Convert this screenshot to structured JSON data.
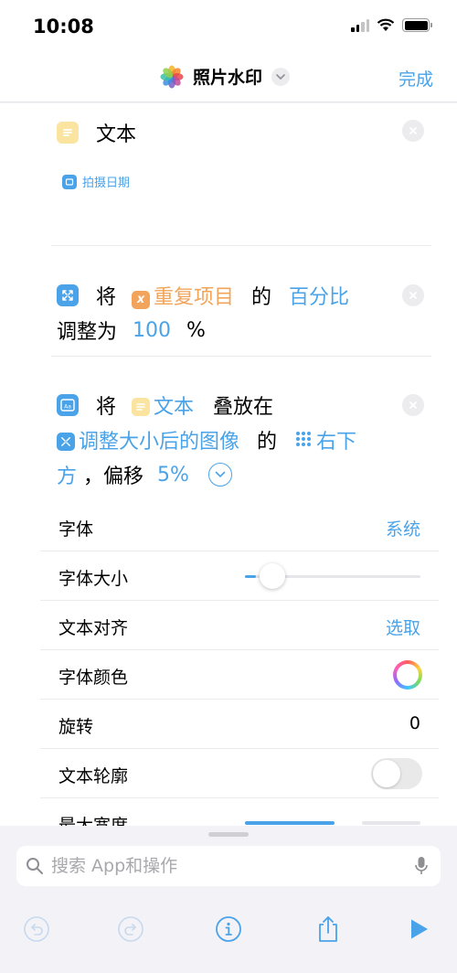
{
  "status_bar": {
    "time": "10:08"
  },
  "nav": {
    "title": "照片水印",
    "done_label": "完成"
  },
  "actions": {
    "text_action": {
      "title": "文本",
      "token": "拍摄日期"
    },
    "resize_action": {
      "word_1": "将",
      "var_name": "重复项目",
      "word_2": "的",
      "mode": "百分比",
      "word_3": "调整为",
      "value": "100",
      "unit": "%"
    },
    "overlay_action": {
      "word_1": "将",
      "var_text": "文本",
      "word_2": "叠放在",
      "var_image": "调整大小后的图像",
      "word_3": "的",
      "position_a": "右下",
      "position_b": "方",
      "word_4": "，偏移",
      "offset": "5%"
    }
  },
  "params": [
    {
      "label": "字体",
      "value": "系统"
    },
    {
      "label": "字体大小",
      "slider_level": 0.06
    },
    {
      "label": "文本对齐",
      "value": "选取"
    },
    {
      "label": "字体颜色"
    },
    {
      "label": "旋转",
      "value": "0"
    },
    {
      "label": "文本轮廓",
      "toggle_on": false
    },
    {
      "label": "最大宽度"
    }
  ],
  "search": {
    "placeholder": "搜索 App和操作"
  },
  "colors": {
    "accent": "#4aa3e8",
    "variable_orange": "#f2a45a",
    "variable_yellow": "#fbe3a0"
  },
  "icons": [
    "photos-icon",
    "chevron-down-icon",
    "text-doc-icon",
    "close-icon",
    "resize-icon",
    "variable-x-icon",
    "overlay-image-icon",
    "grid-position-icon",
    "expand-chevron-icon",
    "search-icon",
    "mic-icon",
    "undo-icon",
    "redo-icon",
    "info-icon",
    "share-icon",
    "play-icon"
  ]
}
